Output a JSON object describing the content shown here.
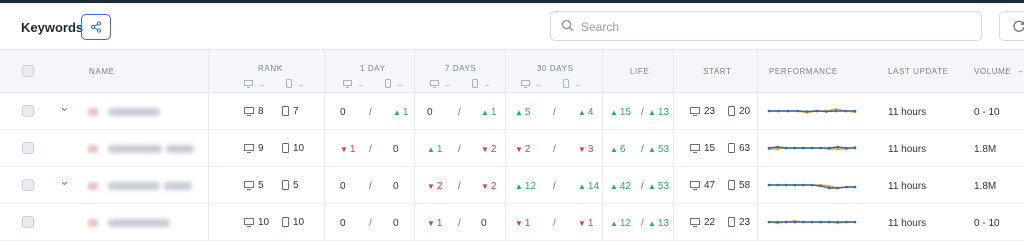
{
  "header": {
    "title": "Keywords",
    "search_placeholder": "Search"
  },
  "columns": {
    "name": "NAME",
    "rank": "RANK",
    "day1": "1 DAY",
    "day7": "7 DAYS",
    "day30": "30 DAYS",
    "life": "LIFE",
    "start": "START",
    "performance": "PERFORMANCE",
    "last_update": "LAST UPDATE",
    "volume": "VOLUME",
    "dash": "–"
  },
  "icons": {
    "desktop": "desktop-icon",
    "mobile": "mobile-icon",
    "up": "▲",
    "down": "▼"
  },
  "colors": {
    "accent": "#2f6fd6",
    "up": "#22b357",
    "down": "#e03a3a",
    "line_blue": "#2b6cb0",
    "line_orange": "#f0a030"
  },
  "rows": [
    {
      "expanded_chevron": "⌄",
      "rank_desktop": "8",
      "rank_mobile": "7",
      "day1_a": {
        "dir": "",
        "val": "0"
      },
      "day1_b": {
        "dir": "up",
        "val": "1"
      },
      "day7_a": {
        "dir": "",
        "val": "0"
      },
      "day7_b": {
        "dir": "up",
        "val": "1"
      },
      "day30_a": {
        "dir": "up",
        "val": "5"
      },
      "day30_b": {
        "dir": "up",
        "val": "4"
      },
      "life_a": "15",
      "life_b": "13",
      "start_desktop": "23",
      "start_mobile": "20",
      "last_update": "11 hours",
      "volume": "0 - 10"
    },
    {
      "expanded_chevron": "",
      "rank_desktop": "9",
      "rank_mobile": "10",
      "day1_a": {
        "dir": "down",
        "val": "1"
      },
      "day1_b": {
        "dir": "",
        "val": "0"
      },
      "day7_a": {
        "dir": "up",
        "val": "1"
      },
      "day7_b": {
        "dir": "down",
        "val": "2"
      },
      "day30_a": {
        "dir": "down",
        "val": "2"
      },
      "day30_b": {
        "dir": "down",
        "val": "3"
      },
      "life_a": "6",
      "life_b": "53",
      "start_desktop": "15",
      "start_mobile": "63",
      "last_update": "11 hours",
      "volume": "1.8M"
    },
    {
      "expanded_chevron": "⌄",
      "rank_desktop": "5",
      "rank_mobile": "5",
      "day1_a": {
        "dir": "",
        "val": "0"
      },
      "day1_b": {
        "dir": "",
        "val": "0"
      },
      "day7_a": {
        "dir": "down",
        "val": "2"
      },
      "day7_b": {
        "dir": "down",
        "val": "2"
      },
      "day30_a": {
        "dir": "up",
        "val": "12"
      },
      "day30_b": {
        "dir": "up",
        "val": "14"
      },
      "life_a": "42",
      "life_b": "53",
      "start_desktop": "47",
      "start_mobile": "58",
      "last_update": "11 hours",
      "volume": "1.8M"
    },
    {
      "expanded_chevron": "",
      "rank_desktop": "10",
      "rank_mobile": "10",
      "day1_a": {
        "dir": "",
        "val": "0"
      },
      "day1_b": {
        "dir": "",
        "val": "0"
      },
      "day7_a": {
        "dir": "down",
        "val": "1"
      },
      "day7_b": {
        "dir": "",
        "val": "0"
      },
      "day30_a": {
        "dir": "down",
        "val": "1"
      },
      "day30_b": {
        "dir": "down",
        "val": "1"
      },
      "life_a": "12",
      "life_b": "13",
      "start_desktop": "22",
      "start_mobile": "23",
      "last_update": "11 hours",
      "volume": "0 - 10"
    }
  ],
  "separator": "/"
}
